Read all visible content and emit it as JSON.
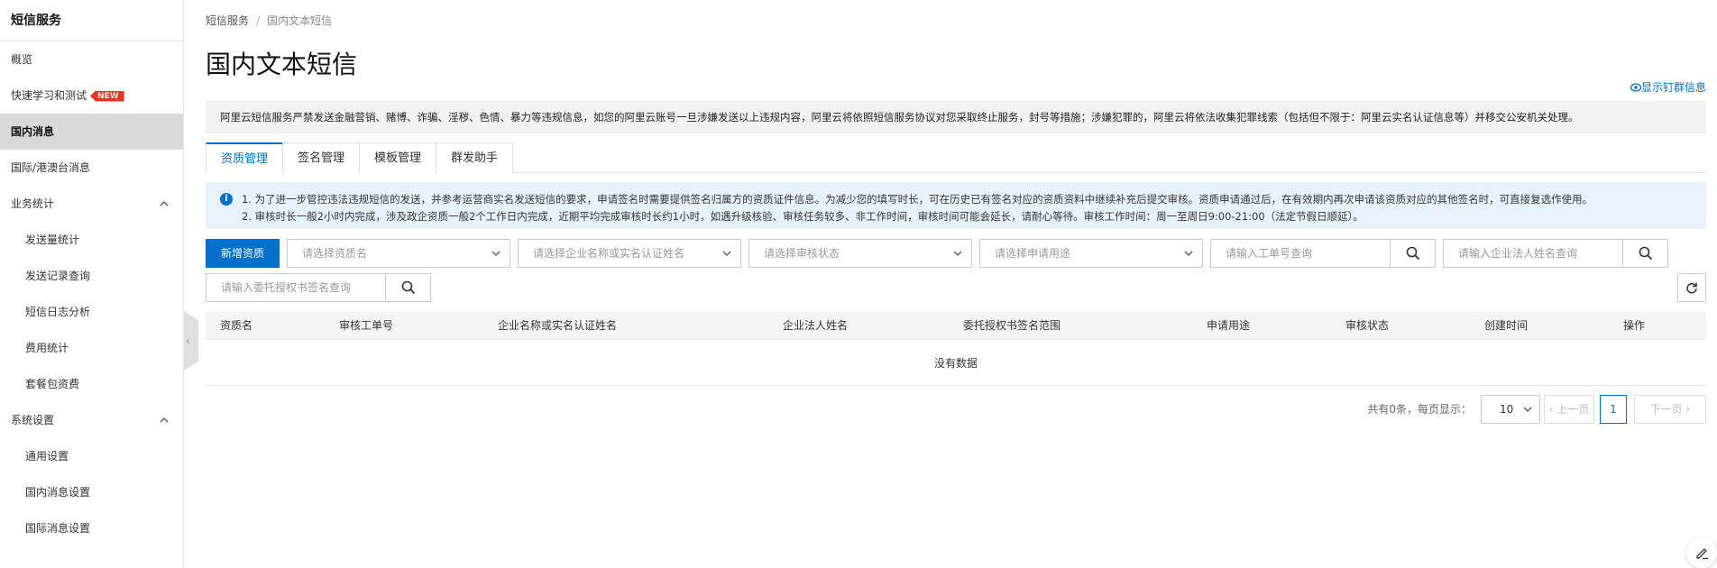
{
  "sidebar": {
    "title": "短信服务",
    "items": [
      {
        "label": "概览"
      },
      {
        "label": "快速学习和测试",
        "badge": "NEW"
      },
      {
        "label": "国内消息"
      },
      {
        "label": "国际/港澳台消息"
      },
      {
        "label": "业务统计"
      },
      {
        "label": "发送量统计"
      },
      {
        "label": "发送记录查询"
      },
      {
        "label": "短信日志分析"
      },
      {
        "label": "费用统计"
      },
      {
        "label": "套餐包资费"
      },
      {
        "label": "系统设置"
      },
      {
        "label": "通用设置"
      },
      {
        "label": "国内消息设置"
      },
      {
        "label": "国际消息设置"
      }
    ]
  },
  "breadcrumb": {
    "root": "短信服务",
    "separator": "/",
    "current": "国内文本短信"
  },
  "page_title": "国内文本短信",
  "show_group_link": "显示钉群信息",
  "notice": "阿里云短信服务严禁发送金融营销、赌博、诈骗、淫秽、色情、暴力等违规信息，如您的阿里云账号一旦涉嫌发送以上违规内容，阿里云将依照短信服务协议对您采取终止服务，封号等措施；涉嫌犯罪的，阿里云将依法收集犯罪线索（包括但不限于：阿里云实名认证信息等）并移交公安机关处理。",
  "tabs": [
    {
      "label": "资质管理"
    },
    {
      "label": "签名管理"
    },
    {
      "label": "模板管理"
    },
    {
      "label": "群发助手"
    }
  ],
  "info": {
    "line1": "1. 为了进一步管控违法违规短信的发送，并参考运营商实名发送短信的要求，申请签名时需要提供签名归属方的资质证件信息。为减少您的填写时长，可在历史已有签名对应的资质资料中继续补充后提交审核。资质申请通过后，在有效期内再次申请该资质对应的其他签名时，可直接复选作使用。",
    "line2": "2. 审核时长一般2小时内完成，涉及政企资质一般2个工作日内完成，近期平均完成审核时长约1小时，如遇升级核验、审核任务较多、非工作时间，审核时间可能会延长，请耐心等待。审核工作时间：周一至周日9:00-21:00（法定节假日顺延）。"
  },
  "toolbar": {
    "add_button": "新增资质",
    "selects": [
      {
        "placeholder": "请选择资质名"
      },
      {
        "placeholder": "请选择企业名称或实名认证姓名"
      },
      {
        "placeholder": "请选择审核状态"
      },
      {
        "placeholder": "请选择申请用途"
      }
    ],
    "search_ticket": "请输入工单号查询",
    "search_legal": "请输入企业法人姓名查询",
    "search_auth": "请输入委托授权书签名查询"
  },
  "table": {
    "columns": [
      "资质名",
      "审核工单号",
      "企业名称或实名认证姓名",
      "企业法人姓名",
      "委托授权书签名范围",
      "申请用途",
      "审核状态",
      "创建时间",
      "操作"
    ],
    "empty_text": "没有数据"
  },
  "pagination": {
    "total_text": "共有0条，每页显示：",
    "page_size": "10",
    "prev": "上一页",
    "current_page": "1",
    "next": "下一页"
  },
  "colors": {
    "accent": "#0070cc",
    "badge": "#e8341c",
    "info_bg": "#e6f3fd"
  }
}
